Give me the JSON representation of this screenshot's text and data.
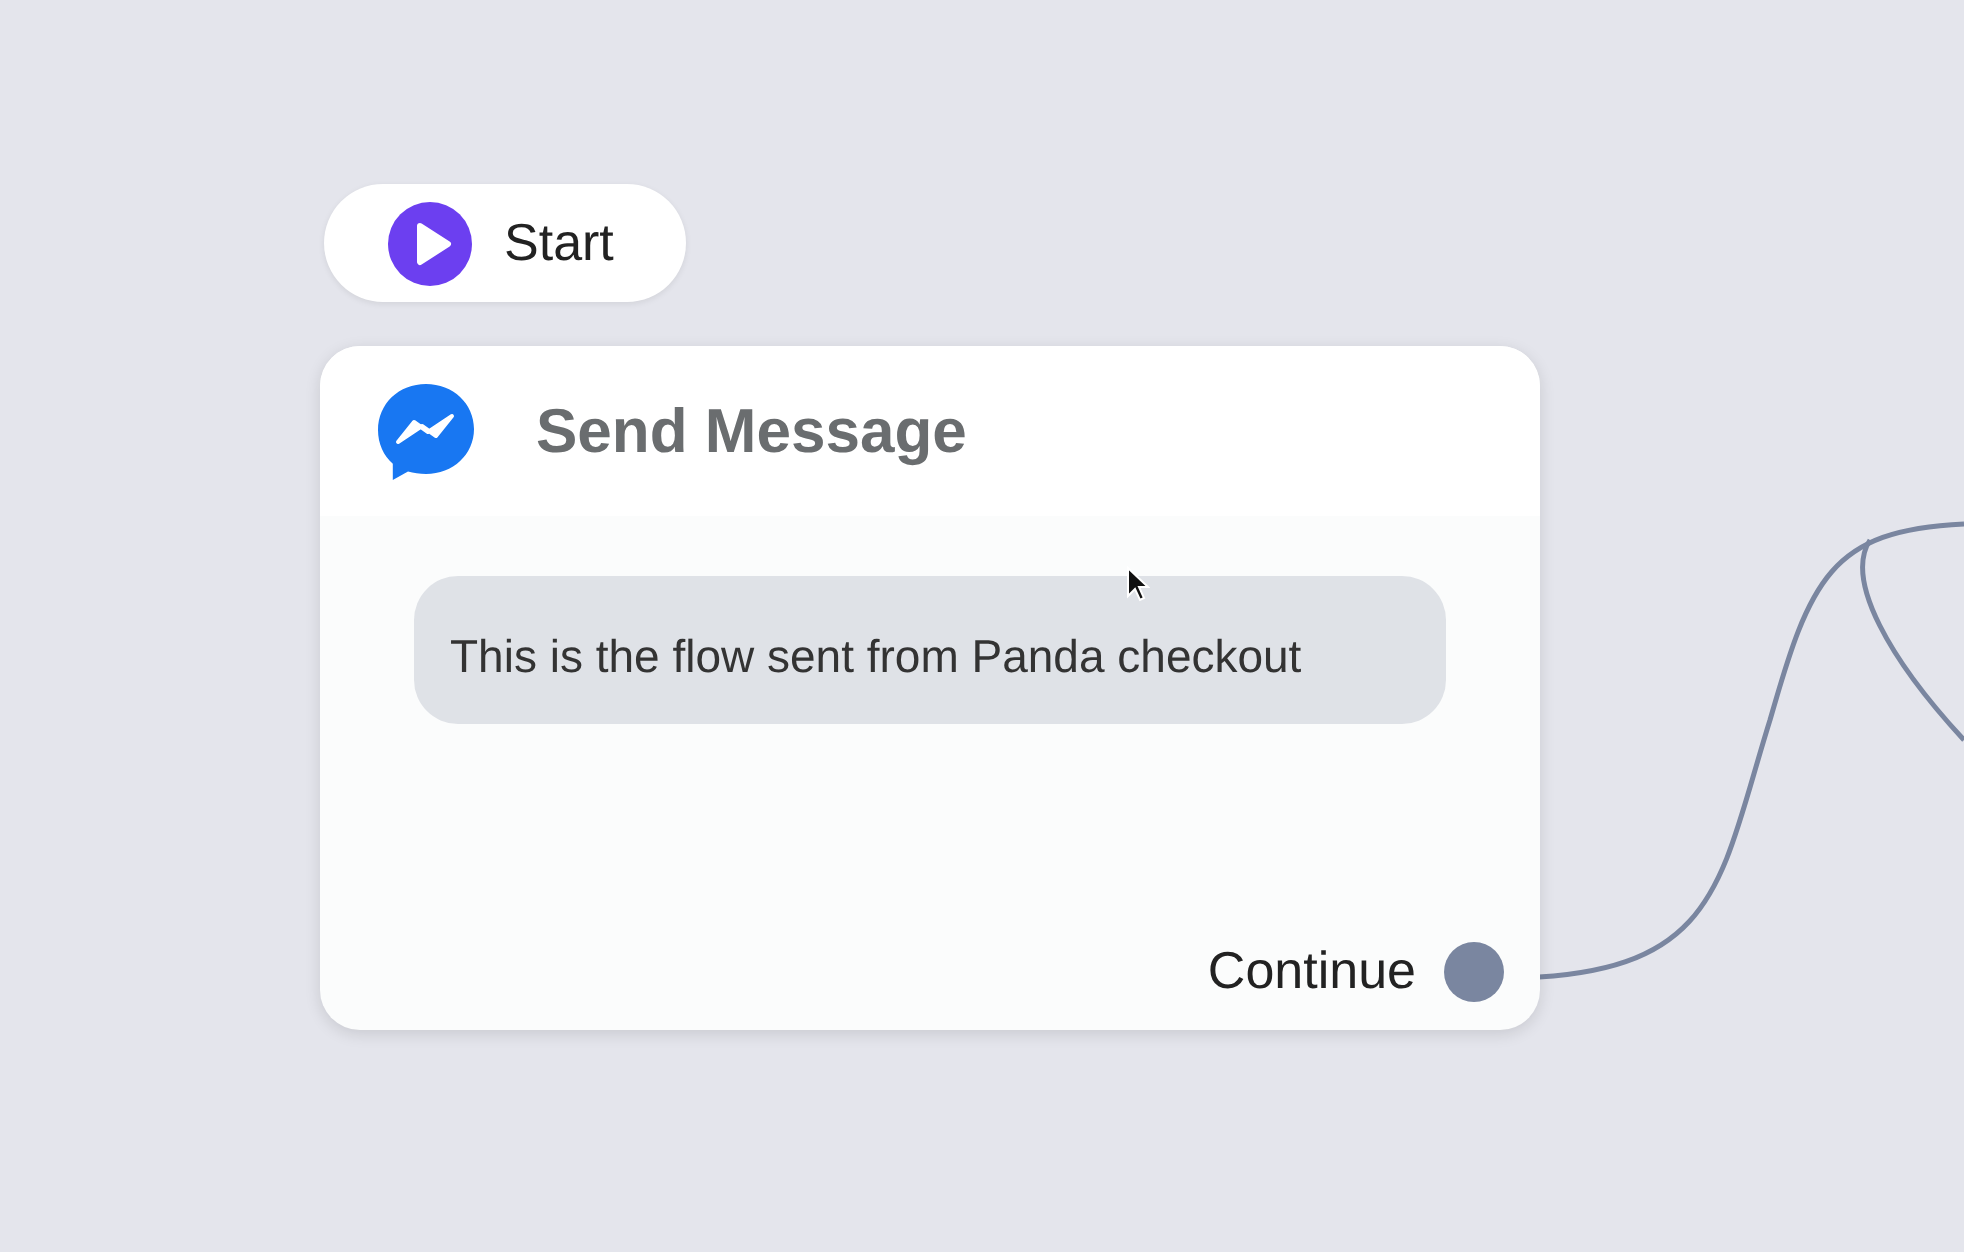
{
  "start": {
    "label": "Start"
  },
  "node": {
    "title": "Send Message",
    "message": "This is the flow sent from Panda checkout",
    "outputs": [
      {
        "label": "Continue"
      }
    ]
  }
}
